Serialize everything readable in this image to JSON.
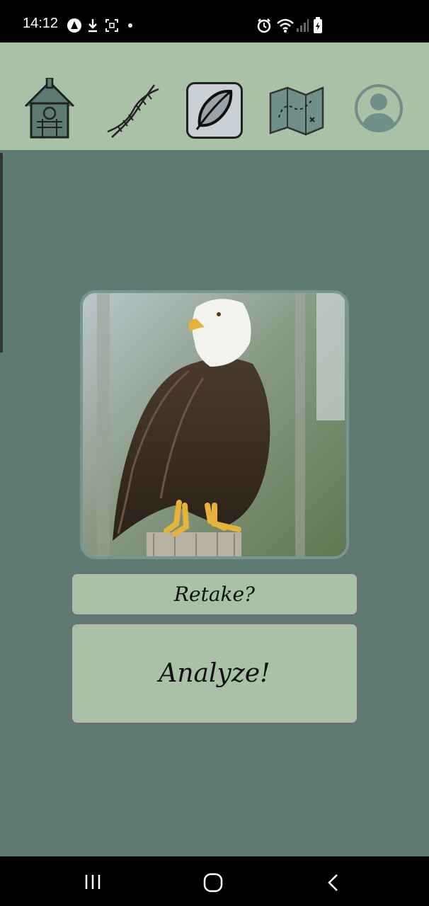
{
  "status_bar": {
    "time": "14:12",
    "left_icons": [
      "app-icon",
      "download-icon",
      "screenshot-icon",
      "dot-icon"
    ],
    "right_icons": [
      "alarm-icon",
      "wifi-icon",
      "signal-icon",
      "battery-icon"
    ]
  },
  "top_nav": {
    "items": [
      {
        "name": "birdhouse-icon",
        "active": false
      },
      {
        "name": "dna-icon",
        "active": false
      },
      {
        "name": "feather-icon",
        "active": true
      },
      {
        "name": "map-icon",
        "active": false
      },
      {
        "name": "profile-icon",
        "active": false
      }
    ]
  },
  "main": {
    "photo": {
      "subject": "bald-eagle-photo"
    },
    "retake_label": "Retake?",
    "analyze_label": "Analyze!"
  },
  "system_nav": {
    "items": [
      "recent-apps-icon",
      "home-icon",
      "back-icon"
    ]
  },
  "colors": {
    "background": "#5e7a73",
    "nav_background": "#a9c2a5",
    "button_background": "#a9c2a5",
    "active_tab": "#c8d0d6"
  }
}
